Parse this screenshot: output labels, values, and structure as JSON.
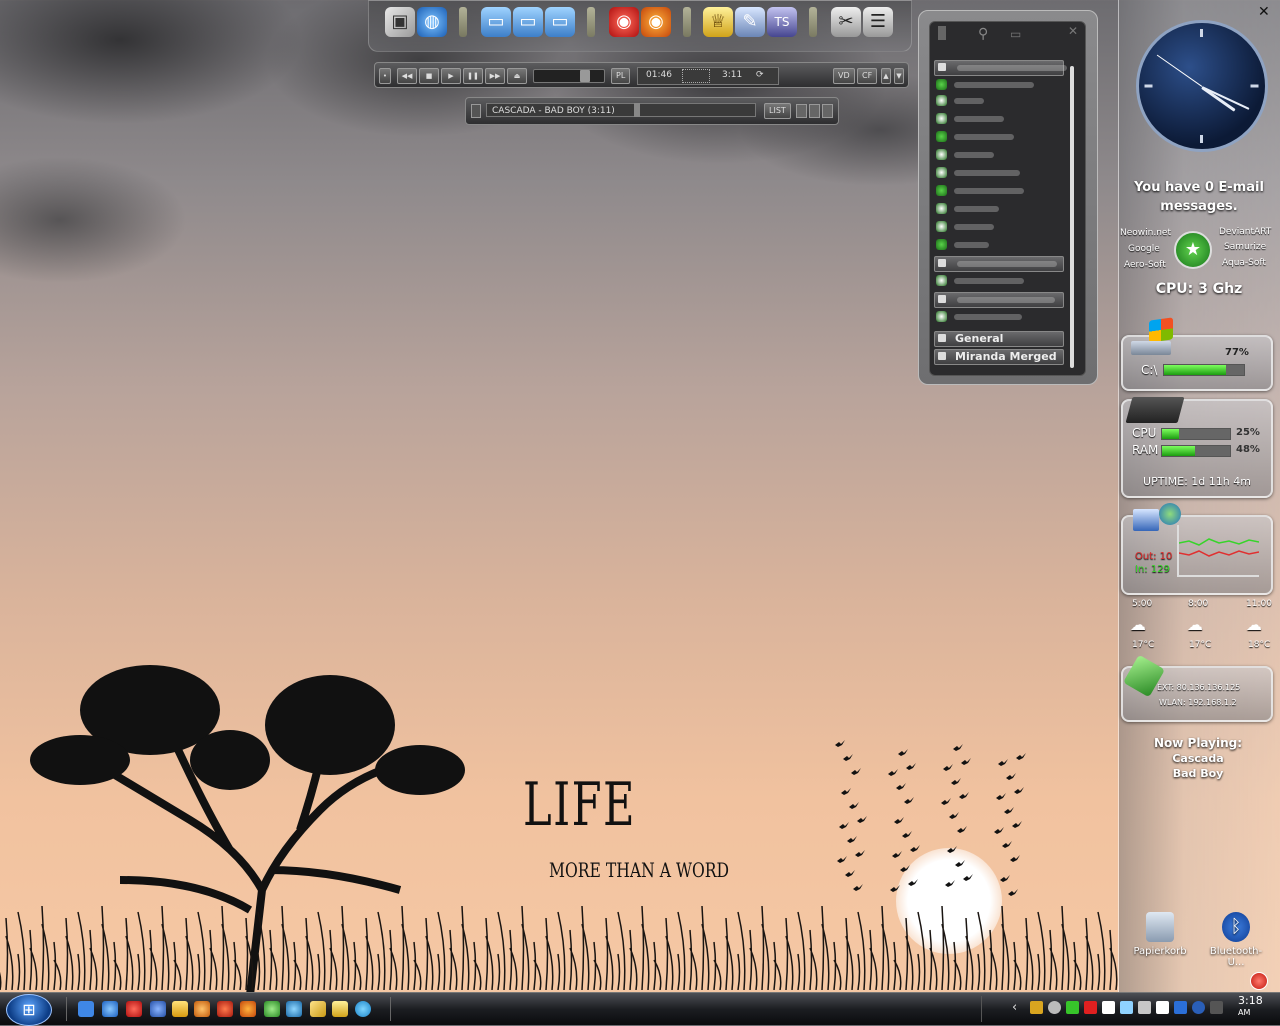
{
  "media_player": {
    "playlist_button": "PL",
    "elapsed": "01:46",
    "duration": "3:11",
    "vd_button": "VD",
    "cf_button": "CF",
    "now_playing_title": "CASCADA - BAD BOY (3:11)",
    "list_button": "LIST"
  },
  "contacts": {
    "groups": [
      {
        "label": "General"
      },
      {
        "label": "Miranda Merged"
      }
    ]
  },
  "email_widget": {
    "line1": "You have  0  E-mail",
    "line2": "messages."
  },
  "links": {
    "left": [
      "Neowin.net",
      "Google",
      "Aero-Soft"
    ],
    "right": [
      "DeviantART",
      "Samurize",
      "Aqua-Soft"
    ]
  },
  "cpu_speed": "CPU: 3 Ghz",
  "disk": {
    "label": "C:\\",
    "percent_text": "77%",
    "percent": 77
  },
  "system": {
    "cpu_label": "CPU",
    "cpu_text": "25%",
    "cpu": 25,
    "ram_label": "RAM",
    "ram_text": "48%",
    "ram": 48,
    "uptime": "UPTIME: 1d 11h 4m"
  },
  "network": {
    "out": "Out: 10",
    "in": "In: 129"
  },
  "weather": [
    {
      "time": "5:00",
      "temp": "17°C"
    },
    {
      "time": "8:00",
      "temp": "17°C"
    },
    {
      "time": "11:00",
      "temp": "18°C"
    }
  ],
  "ip": {
    "ext": "EXT: 80.136.136.125",
    "wlan": "WLAN: 192.168.1.2"
  },
  "now_playing": {
    "heading": "Now Playing:",
    "artist": "Cascada",
    "track": "Bad Boy"
  },
  "wallpaper": {
    "title": "LIFE",
    "subtitle": "MORE THAN A WORD"
  },
  "desktop_icons": [
    {
      "label": "Papierkorb"
    },
    {
      "label": "Bluetooth-U..."
    }
  ],
  "clock_time": {
    "top": "3:18",
    "bottom": "AM"
  },
  "close_glyph": "✕",
  "accent": {
    "progress": "#2cc31a",
    "net_out": "#e03030",
    "net_in": "#37d42a"
  }
}
